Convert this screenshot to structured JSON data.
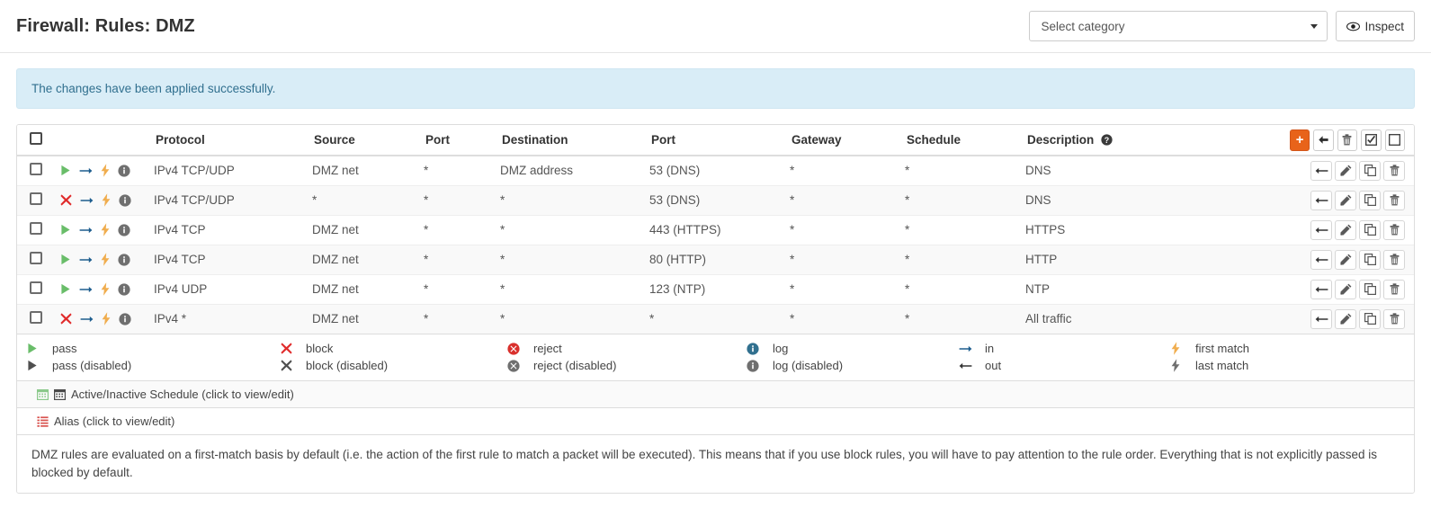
{
  "header": {
    "title": "Firewall: Rules: DMZ",
    "select_category": {
      "value": "Select category",
      "icon": "chevron-down-icon"
    },
    "inspect_button": {
      "label": "Inspect",
      "icon": "eye-icon"
    }
  },
  "alert": {
    "message": "The changes have been applied successfully."
  },
  "table": {
    "columns": [
      "",
      "",
      "Protocol",
      "Source",
      "Port",
      "Destination",
      "Port",
      "Gateway",
      "Schedule",
      "Description"
    ],
    "description_help_icon": "question-circle-icon",
    "header_actions": [
      {
        "name": "add-rule-button",
        "icon": "plus-icon",
        "label": "+"
      },
      {
        "name": "move-selected-button",
        "icon": "arrow-left-icon",
        "label": ""
      },
      {
        "name": "delete-selected-button",
        "icon": "trash-icon",
        "label": ""
      },
      {
        "name": "select-all-button",
        "icon": "checked-box-icon",
        "label": ""
      },
      {
        "name": "deselect-all-button",
        "icon": "empty-box-icon",
        "label": ""
      }
    ],
    "row_actions": [
      {
        "name": "move-rule-button",
        "icon": "arrow-left-icon"
      },
      {
        "name": "edit-rule-button",
        "icon": "pencil-icon"
      },
      {
        "name": "copy-rule-button",
        "icon": "copy-icon"
      },
      {
        "name": "delete-rule-button",
        "icon": "trash-icon"
      }
    ],
    "rows": [
      {
        "action": "pass",
        "action_icon": "green-play-icon",
        "direction": "in",
        "direction_icon": "arrow-right-icon",
        "match": "first match",
        "match_icon": "bolt-icon",
        "log": "log",
        "log_icon": "info-circle-icon",
        "protocol": "IPv4 TCP/UDP",
        "source": "DMZ net",
        "source_port": "*",
        "destination": "DMZ address",
        "dest_port": "53 (DNS)",
        "gateway": "*",
        "schedule": "*",
        "description": "DNS"
      },
      {
        "action": "block",
        "action_icon": "red-x-icon",
        "direction": "in",
        "direction_icon": "arrow-right-icon",
        "match": "first match",
        "match_icon": "bolt-icon",
        "log": "log",
        "log_icon": "info-circle-icon",
        "protocol": "IPv4 TCP/UDP",
        "source": "*",
        "source_port": "*",
        "destination": "*",
        "dest_port": "53 (DNS)",
        "gateway": "*",
        "schedule": "*",
        "description": "DNS"
      },
      {
        "action": "pass",
        "action_icon": "green-play-icon",
        "direction": "in",
        "direction_icon": "arrow-right-icon",
        "match": "first match",
        "match_icon": "bolt-icon",
        "log": "log",
        "log_icon": "info-circle-icon",
        "protocol": "IPv4 TCP",
        "source": "DMZ net",
        "source_port": "*",
        "destination": "*",
        "dest_port": "443 (HTTPS)",
        "gateway": "*",
        "schedule": "*",
        "description": "HTTPS"
      },
      {
        "action": "pass",
        "action_icon": "green-play-icon",
        "direction": "in",
        "direction_icon": "arrow-right-icon",
        "match": "first match",
        "match_icon": "bolt-icon",
        "log": "log",
        "log_icon": "info-circle-icon",
        "protocol": "IPv4 TCP",
        "source": "DMZ net",
        "source_port": "*",
        "destination": "*",
        "dest_port": "80 (HTTP)",
        "gateway": "*",
        "schedule": "*",
        "description": "HTTP"
      },
      {
        "action": "pass",
        "action_icon": "green-play-icon",
        "direction": "in",
        "direction_icon": "arrow-right-icon",
        "match": "first match",
        "match_icon": "bolt-icon",
        "log": "log",
        "log_icon": "info-circle-icon",
        "protocol": "IPv4 UDP",
        "source": "DMZ net",
        "source_port": "*",
        "destination": "*",
        "dest_port": "123 (NTP)",
        "gateway": "*",
        "schedule": "*",
        "description": "NTP"
      },
      {
        "action": "block",
        "action_icon": "red-x-icon",
        "direction": "in",
        "direction_icon": "arrow-right-icon",
        "match": "first match",
        "match_icon": "bolt-icon",
        "log": "log",
        "log_icon": "info-circle-icon",
        "protocol": "IPv4 *",
        "source": "DMZ net",
        "source_port": "*",
        "destination": "*",
        "dest_port": "*",
        "gateway": "*",
        "schedule": "*",
        "description": "All traffic"
      }
    ]
  },
  "legend": {
    "items": [
      {
        "icon": "green-play-icon",
        "label": "pass"
      },
      {
        "icon": "red-x-icon",
        "label": "block"
      },
      {
        "icon": "red-circle-x-icon",
        "label": "reject"
      },
      {
        "icon": "blue-info-circle-icon",
        "label": "log"
      },
      {
        "icon": "arrow-right-icon",
        "label": "in"
      },
      {
        "icon": "orange-bolt-icon",
        "label": "first match"
      },
      {
        "icon": "grey-play-icon",
        "label": "pass (disabled)"
      },
      {
        "icon": "grey-x-icon",
        "label": "block (disabled)"
      },
      {
        "icon": "grey-circle-x-icon",
        "label": "reject (disabled)"
      },
      {
        "icon": "grey-info-circle-icon",
        "label": "log (disabled)"
      },
      {
        "icon": "arrow-left-icon",
        "label": "out"
      },
      {
        "icon": "grey-bolt-icon",
        "label": "last match"
      }
    ],
    "schedule_row": {
      "icons": [
        "green-calendar-icon",
        "dark-calendar-icon"
      ],
      "label": "Active/Inactive Schedule (click to view/edit)"
    },
    "alias_row": {
      "icon": "orange-list-icon",
      "label": "Alias (click to view/edit)"
    }
  },
  "footnote": {
    "text": "DMZ rules are evaluated on a first-match basis by default (i.e. the action of the first rule to match a packet will be executed). This means that if you use block rules, you will have to pay attention to the rule order. Everything that is not explicitly passed is blocked by default."
  },
  "colors": {
    "pass_green": "#69bd69",
    "block_red": "#e02b2b",
    "bolt_orange": "#f0ad4e",
    "log_blue": "#31708f",
    "arrow_blue": "#1d5d8e",
    "add_orange": "#e8631a",
    "alert_bg": "#d9edf7",
    "alias_orange": "#d9534f"
  }
}
